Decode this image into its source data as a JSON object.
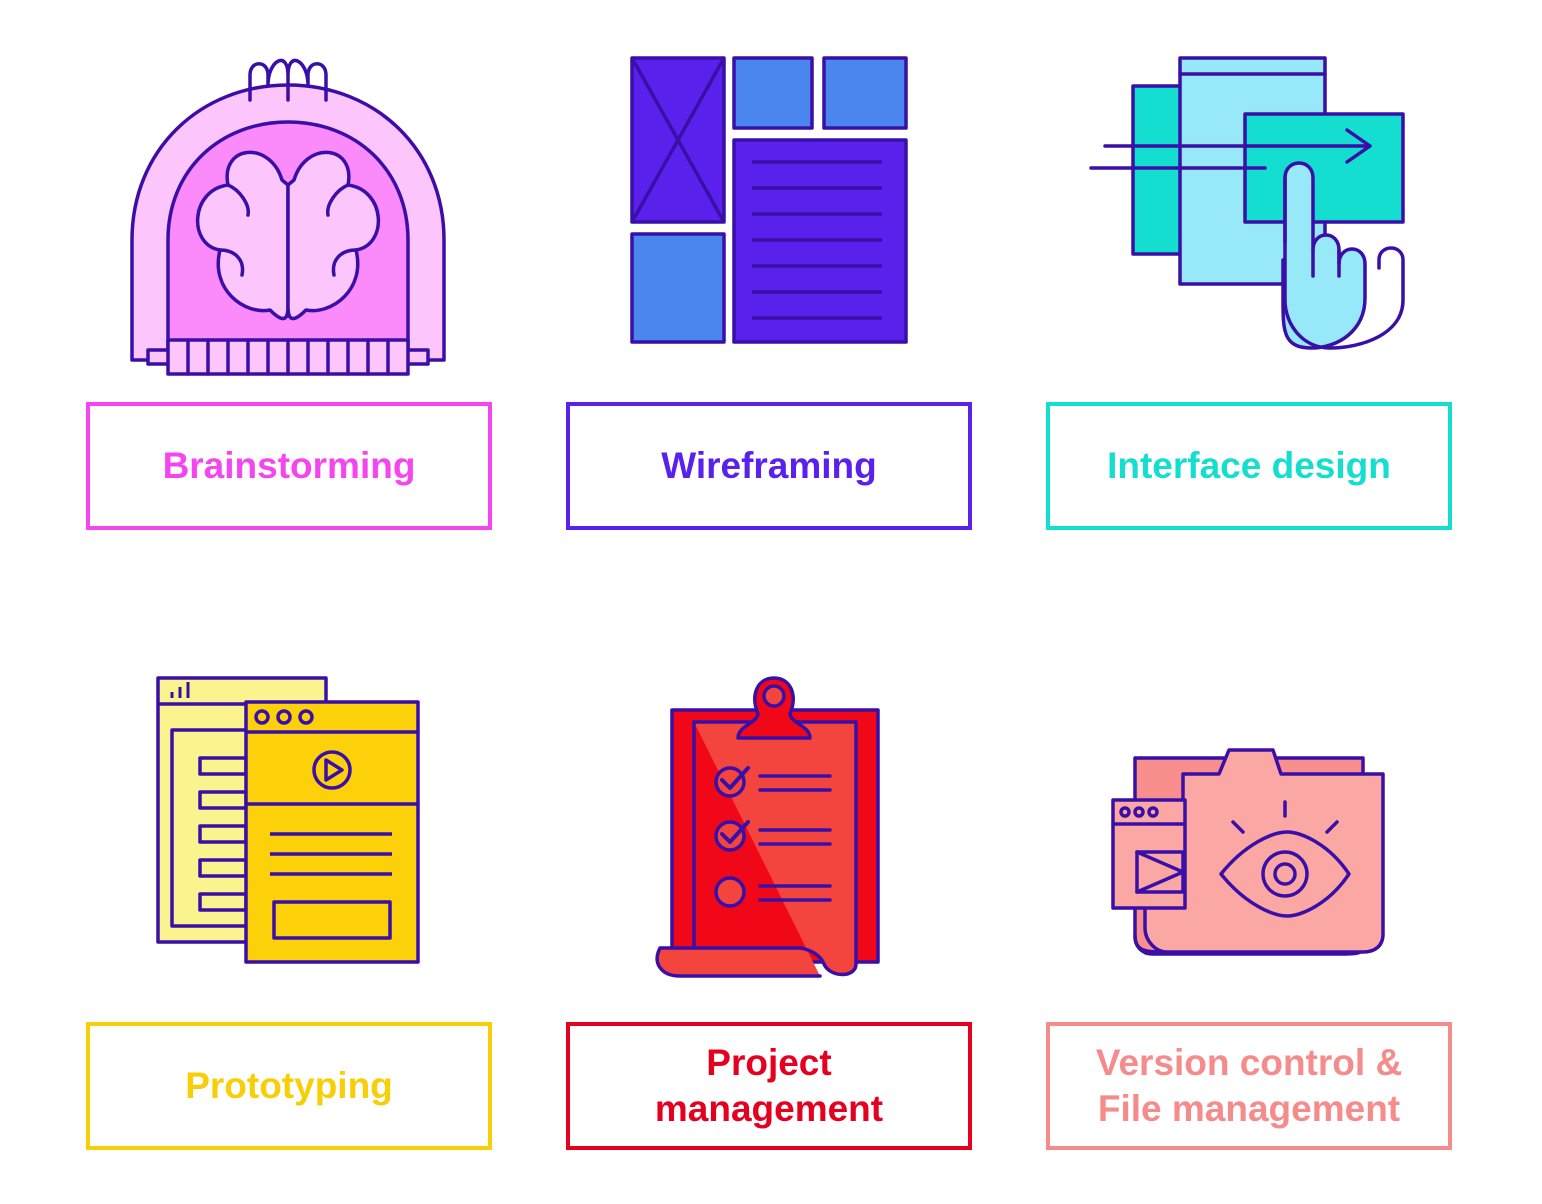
{
  "cards": [
    {
      "id": "brainstorming",
      "label_lines": [
        "Brainstorming"
      ],
      "icon": "brain-dome-icon",
      "color": "#f545f0"
    },
    {
      "id": "wireframing",
      "label_lines": [
        "Wireframing"
      ],
      "icon": "wireframe-grid-icon",
      "color": "#5a21ec"
    },
    {
      "id": "interface",
      "label_lines": [
        "Interface design"
      ],
      "icon": "touch-screens-icon",
      "color": "#14ded0"
    },
    {
      "id": "prototyping",
      "label_lines": [
        "Prototyping"
      ],
      "icon": "prototype-windows-icon",
      "color": "#f8cf07"
    },
    {
      "id": "project",
      "label_lines": [
        "Project",
        "management"
      ],
      "icon": "clipboard-checklist-icon",
      "color": "#e6001f"
    },
    {
      "id": "version",
      "label_lines": [
        "Version control &",
        "File management"
      ],
      "icon": "folder-eye-icon",
      "color": "#f58b8b"
    }
  ],
  "colors": {
    "stroke": "#3a0fa8"
  }
}
